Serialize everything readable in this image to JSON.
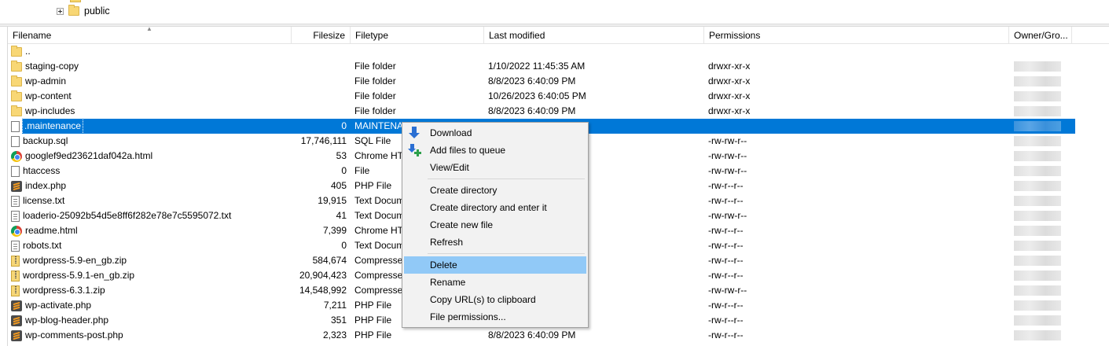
{
  "tree": {
    "node_label": "public"
  },
  "columns": {
    "filename": "Filename",
    "filesize": "Filesize",
    "filetype": "Filetype",
    "last_modified": "Last modified",
    "permissions": "Permissions",
    "owner": "Owner/Gro..."
  },
  "rows": [
    {
      "name": "..",
      "size": "",
      "type": "",
      "modified": "",
      "perm": "",
      "icon": "folder-icon",
      "owner_visible": false
    },
    {
      "name": "staging-copy",
      "size": "",
      "type": "File folder",
      "modified": "1/10/2022 11:45:35 AM",
      "perm": "drwxr-xr-x",
      "icon": "folder-icon",
      "owner_visible": true
    },
    {
      "name": "wp-admin",
      "size": "",
      "type": "File folder",
      "modified": "8/8/2023 6:40:09 PM",
      "perm": "drwxr-xr-x",
      "icon": "folder-icon",
      "owner_visible": true
    },
    {
      "name": "wp-content",
      "size": "",
      "type": "File folder",
      "modified": "10/26/2023 6:40:05 PM",
      "perm": "drwxr-xr-x",
      "icon": "folder-icon",
      "owner_visible": true
    },
    {
      "name": "wp-includes",
      "size": "",
      "type": "File folder",
      "modified": "8/8/2023 6:40:09 PM",
      "perm": "drwxr-xr-x",
      "icon": "folder-icon",
      "owner_visible": true
    },
    {
      "name": ".maintenance",
      "size": "0",
      "type": "MAINTENA",
      "modified": "",
      "perm": "",
      "icon": "document-icon",
      "owner_visible": true,
      "selected": true
    },
    {
      "name": "backup.sql",
      "size": "17,746,111",
      "type": "SQL File",
      "modified": "",
      "perm": "-rw-rw-r--",
      "icon": "document-icon",
      "owner_visible": true
    },
    {
      "name": "googlef9ed23621daf042a.html",
      "size": "53",
      "type": "Chrome HT",
      "modified": "",
      "perm": "-rw-rw-r--",
      "icon": "chrome-icon",
      "owner_visible": true
    },
    {
      "name": "htaccess",
      "size": "0",
      "type": "File",
      "modified": "",
      "perm": "-rw-rw-r--",
      "icon": "document-icon",
      "owner_visible": true
    },
    {
      "name": "index.php",
      "size": "405",
      "type": "PHP File",
      "modified": "",
      "perm": "-rw-r--r--",
      "icon": "sublime-icon",
      "owner_visible": true
    },
    {
      "name": "license.txt",
      "size": "19,915",
      "type": "Text Docum",
      "modified": "",
      "perm": "-rw-r--r--",
      "icon": "text-document-icon",
      "owner_visible": true
    },
    {
      "name": "loaderio-25092b54d5e8ff6f282e78e7c5595072.txt",
      "size": "41",
      "type": "Text Docum",
      "modified": "",
      "perm": "-rw-rw-r--",
      "icon": "text-document-icon",
      "owner_visible": true
    },
    {
      "name": "readme.html",
      "size": "7,399",
      "type": "Chrome HT",
      "modified": "",
      "perm": "-rw-r--r--",
      "icon": "chrome-icon",
      "owner_visible": true
    },
    {
      "name": "robots.txt",
      "size": "0",
      "type": "Text Docum",
      "modified": "",
      "perm": "-rw-r--r--",
      "icon": "text-document-icon",
      "owner_visible": true
    },
    {
      "name": "wordpress-5.9-en_gb.zip",
      "size": "584,674",
      "type": "Compresse",
      "modified": "",
      "perm": "-rw-r--r--",
      "icon": "zip-icon",
      "owner_visible": true
    },
    {
      "name": "wordpress-5.9.1-en_gb.zip",
      "size": "20,904,423",
      "type": "Compresse",
      "modified": "",
      "perm": "-rw-r--r--",
      "icon": "zip-icon",
      "owner_visible": true
    },
    {
      "name": "wordpress-6.3.1.zip",
      "size": "14,548,992",
      "type": "Compresse",
      "modified": "",
      "perm": "-rw-rw-r--",
      "icon": "zip-icon",
      "owner_visible": true
    },
    {
      "name": "wp-activate.php",
      "size": "7,211",
      "type": "PHP File",
      "modified": "",
      "perm": "-rw-r--r--",
      "icon": "sublime-icon",
      "owner_visible": true
    },
    {
      "name": "wp-blog-header.php",
      "size": "351",
      "type": "PHP File",
      "modified": "",
      "perm": "-rw-r--r--",
      "icon": "sublime-icon",
      "owner_visible": true
    },
    {
      "name": "wp-comments-post.php",
      "size": "2,323",
      "type": "PHP File",
      "modified": "8/8/2023 6:40:09 PM",
      "perm": "-rw-r--r--",
      "icon": "sublime-icon",
      "owner_visible": true
    }
  ],
  "context_menu": {
    "items": [
      {
        "label": "Download",
        "icon": "download-arrow-icon"
      },
      {
        "label": "Add files to queue",
        "icon": "add-to-queue-icon"
      },
      {
        "label": "View/Edit"
      },
      {
        "separator": true
      },
      {
        "label": "Create directory"
      },
      {
        "label": "Create directory and enter it"
      },
      {
        "label": "Create new file"
      },
      {
        "label": "Refresh"
      },
      {
        "separator": true
      },
      {
        "label": "Delete",
        "highlighted": true
      },
      {
        "label": "Rename"
      },
      {
        "label": "Copy URL(s) to clipboard"
      },
      {
        "label": "File permissions..."
      }
    ]
  },
  "colors": {
    "selection": "#0078d7",
    "menu_hover": "#91c9f7"
  }
}
